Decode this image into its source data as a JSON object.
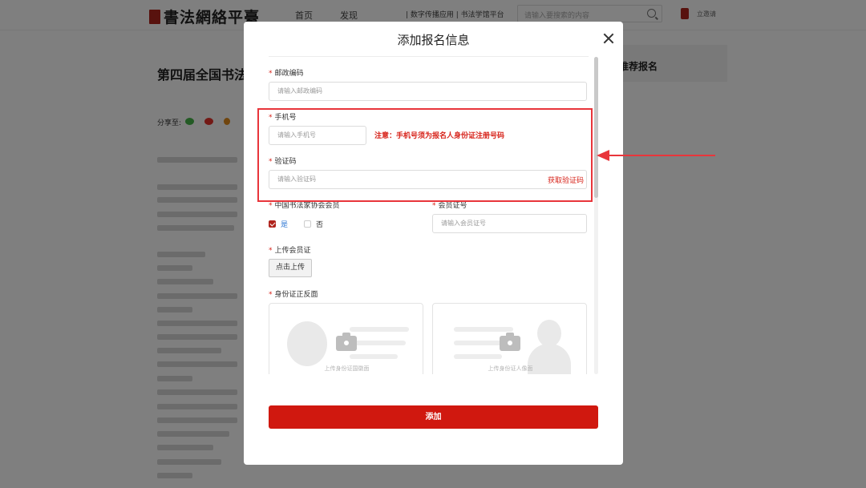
{
  "header": {
    "logo": "書法網絡平臺",
    "nav": [
      "首页",
      "发现"
    ],
    "links": "| 数字传播应用 | 书法学馆平台",
    "search_placeholder": "请输入要搜索的内容",
    "user": "立邀请"
  },
  "article": {
    "title": "第四届全国书法事",
    "share_label": "分享至:"
  },
  "side": {
    "recommend": "推荐报名"
  },
  "modal": {
    "title": "添加报名信息",
    "postal": {
      "label": "邮政编码",
      "placeholder": "请输入邮政编码"
    },
    "phone": {
      "label": "手机号",
      "placeholder": "请输入手机号",
      "note": "注意：手机号须为报名人身份证注册号码"
    },
    "code": {
      "label": "验证码",
      "placeholder": "请输入验证码",
      "link": "获取验证码"
    },
    "member": {
      "label": "中国书法家协会会员",
      "yes": "是",
      "no": "否"
    },
    "member_no": {
      "label": "会员证号",
      "placeholder": "请输入会员证号"
    },
    "upload_card": {
      "label": "上传会员证",
      "button": "点击上传"
    },
    "id_card": {
      "label": "身份证正反面",
      "front": "上传身份证国徽面",
      "back": "上传身份证人像面"
    },
    "submit": "添加"
  },
  "colors": {
    "accent": "#d0180f",
    "annotation": "#e8353b"
  }
}
